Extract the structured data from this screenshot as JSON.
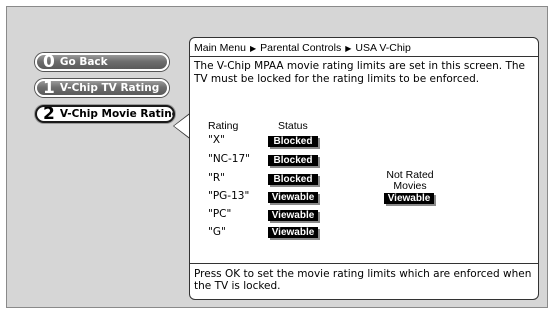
{
  "menu": {
    "items": [
      {
        "number": "0",
        "label": "Go Back"
      },
      {
        "number": "1",
        "label": "V-Chip TV Rating"
      },
      {
        "number": "2",
        "label": "V-Chip Movie Rating"
      }
    ]
  },
  "breadcrumb": [
    "Main Menu",
    "Parental Controls",
    "USA V-Chip"
  ],
  "description": "The V-Chip MPAA movie rating limits are set in this screen. The TV must be locked for the rating limits to be enforced.",
  "table": {
    "headers": {
      "rating": "Rating",
      "status": "Status"
    },
    "rows": [
      {
        "rating": "\"X\"",
        "status": "Blocked"
      },
      {
        "rating": "\"NC-17\"",
        "status": "Blocked"
      },
      {
        "rating": "\"R\"",
        "status": "Blocked"
      },
      {
        "rating": "\"PG-13\"",
        "status": "Viewable"
      },
      {
        "rating": "\"PC\"",
        "status": "Viewable"
      },
      {
        "rating": "\"G\"",
        "status": "Viewable"
      }
    ]
  },
  "not_rated": {
    "label_line1": "Not Rated",
    "label_line2": "Movies",
    "status": "Viewable"
  },
  "footer": "Press OK to set the movie rating limits which are enforced when the TV is locked."
}
